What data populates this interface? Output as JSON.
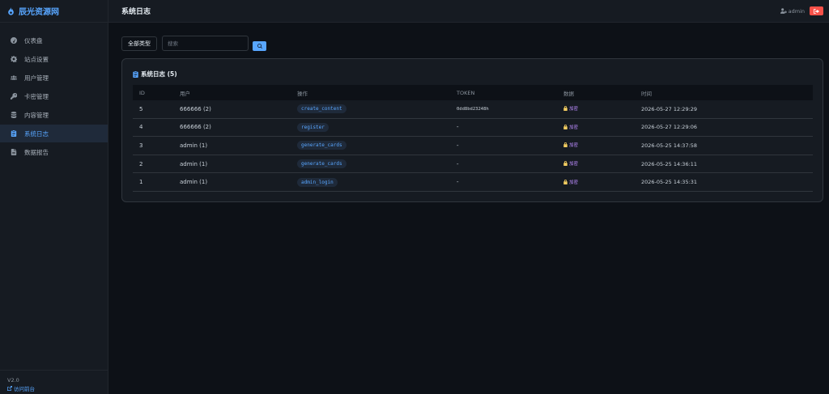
{
  "sidebar": {
    "brand": "辰光资源网",
    "items": [
      {
        "label": "仪表盘",
        "icon": "gauge-icon"
      },
      {
        "label": "站点设置",
        "icon": "gear-icon"
      },
      {
        "label": "用户管理",
        "icon": "users-icon"
      },
      {
        "label": "卡密管理",
        "icon": "key-icon"
      },
      {
        "label": "内容管理",
        "icon": "database-icon"
      },
      {
        "label": "系统日志",
        "icon": "clipboard-icon",
        "active": true
      },
      {
        "label": "数据报告",
        "icon": "file-icon"
      }
    ],
    "version": "V2.0",
    "visit_label": "访问前台"
  },
  "header": {
    "title": "系统日志",
    "user": "admin"
  },
  "filters": {
    "type_value": "全部类型",
    "search_placeholder": "搜索"
  },
  "card": {
    "title": "系统日志 (5)",
    "columns": [
      "ID",
      "用户",
      "操作",
      "TOKEN",
      "数据",
      "时间"
    ],
    "rows": [
      {
        "id": "5",
        "user": "666666 (2)",
        "action": "create_content",
        "token": "0dd8bd23248h",
        "data": "加密",
        "time": "2026-05-27 12:29:29"
      },
      {
        "id": "4",
        "user": "666666 (2)",
        "action": "register",
        "token": "-",
        "data": "加密",
        "time": "2026-05-27 12:29:06"
      },
      {
        "id": "3",
        "user": "admin (1)",
        "action": "generate_cards",
        "token": "-",
        "data": "加密",
        "time": "2026-05-25 14:37:58"
      },
      {
        "id": "2",
        "user": "admin (1)",
        "action": "generate_cards",
        "token": "-",
        "data": "加密",
        "time": "2026-05-25 14:36:11"
      },
      {
        "id": "1",
        "user": "admin (1)",
        "action": "admin_login",
        "token": "-",
        "data": "加密",
        "time": "2026-05-25 14:35:31"
      }
    ]
  },
  "colors": {
    "accent": "#58a6ff",
    "danger": "#f85149",
    "encrypted": "#bc8cff",
    "lock": "#f2cc60"
  }
}
